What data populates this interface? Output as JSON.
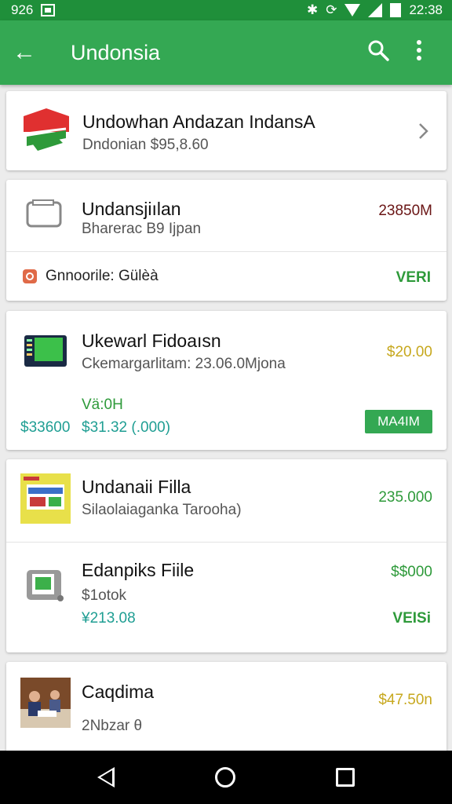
{
  "status_bar": {
    "left_text": "926",
    "time": "22:38"
  },
  "app_bar": {
    "title": "Undonsia",
    "back_icon": "arrow-left-icon",
    "search_icon": "search-icon",
    "menu_icon": "more-vert-icon"
  },
  "items": [
    {
      "title": "Undowhan Andazan IndansA",
      "subtitle": "Dndonian  $95,8.60",
      "icon": "flag-logo-icon"
    },
    {
      "title": "Undansjiılan",
      "subtitle": "Bharerac B9 Ijpan",
      "amount": "23850M",
      "icon": "device-icon",
      "footer_label": "Gnnoorile: Gülèà",
      "footer_action": "VERI"
    },
    {
      "title": "Ukewarl Fidoaısn",
      "subtitle": "Ckemargarlitam: 23.06.0Mjona",
      "amount": "$20.00",
      "icon": "tablet-icon",
      "extra_label": "Vä:0H",
      "extra_value_left": "$33600",
      "extra_value_mid": "$31.32 (.000)",
      "badge": "MA4IM"
    },
    {
      "title": "Undanaii Filla",
      "subtitle": "Silaolaiaganka Tarooha)",
      "amount": "235.000",
      "icon": "product-box-icon"
    },
    {
      "title": "Edanpiks Fiile",
      "subtitle": "$1otok",
      "value": "¥213.08",
      "amount": "$$000",
      "action": "VEISi",
      "icon": "green-tablet-icon"
    },
    {
      "title": "Caqdima",
      "subtitle": "2Nbzar  θ",
      "amount": "$47.50n",
      "icon": "photo-thumbnail-icon"
    }
  ],
  "colors": {
    "primary": "#34a853",
    "status": "#1f8f3a",
    "green_text": "#2e9a3a",
    "teal_text": "#1f9e93",
    "gold_text": "#c7a81e"
  }
}
